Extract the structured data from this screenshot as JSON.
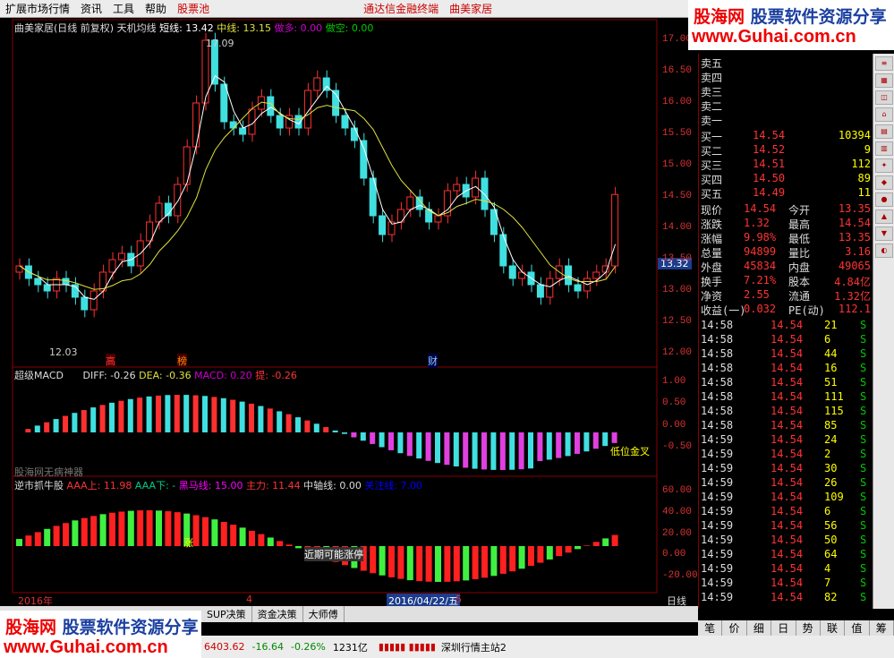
{
  "menubar": {
    "items": [
      "扩展市场行情",
      "资讯",
      "工具",
      "帮助",
      "股票池"
    ],
    "center1": "通达信金融终端",
    "center2": "曲美家居"
  },
  "watermark": {
    "brand": "股海网",
    "sub": "股票软件资源分享",
    "url": "www.Guhai.com.cn"
  },
  "kline_header": {
    "title": "曲美家居(日线 前复权) 天机均线",
    "short_label": "短线: 13.42",
    "mid_label": "中线: 13.15",
    "long_label": "做多: 0.00",
    "short_label2": "做空: 0.00",
    "high_mark": "17.09",
    "low_mark": "12.03",
    "current_price": "13.32"
  },
  "kline_yaxis": [
    "17.00",
    "16.50",
    "16.00",
    "15.50",
    "15.00",
    "14.50",
    "14.00",
    "13.50",
    "13.00",
    "12.50",
    "12.00"
  ],
  "kline_tags": {
    "gao": "高",
    "bang": "榜",
    "cai": "财"
  },
  "macd_header": {
    "title": "超级MACD",
    "diff": "DIFF: -0.26",
    "dea": "DEA: -0.36",
    "macd": "MACD: 0.20",
    "note": "提: -0.26"
  },
  "macd_yaxis": [
    "1.00",
    "0.50",
    "0.00",
    "-0.50"
  ],
  "macd_label": "低位金叉",
  "macd_bottom": "股海网无病神器",
  "niu_header": {
    "title": "逆市抓牛股",
    "aaa_up": "AAA上: 11.98",
    "aaa_down": "AAA下: -",
    "black_horse": "黑马线: 15.00",
    "main": "主力: 11.44",
    "mid": "中轴线: 0.00",
    "focus": "关注线: 7.00"
  },
  "niu_yaxis": [
    "60.00",
    "40.00",
    "20.00",
    "0.00",
    "-20.00"
  ],
  "niu_label": "近期可能涨停",
  "niu_zhang": "涨",
  "xaxis": {
    "y2016": "2016年",
    "m4": "4",
    "date": "2016/04/22/五",
    "m5": "5",
    "period": "日线"
  },
  "bottom_tabs": [
    "SUP决策",
    "资金决策",
    "大师傅"
  ],
  "quote": {
    "sell": [
      {
        "l": "卖五",
        "p": "",
        "v": ""
      },
      {
        "l": "卖四",
        "p": "",
        "v": ""
      },
      {
        "l": "卖三",
        "p": "",
        "v": ""
      },
      {
        "l": "卖二",
        "p": "",
        "v": ""
      },
      {
        "l": "卖一",
        "p": "",
        "v": ""
      }
    ],
    "buy": [
      {
        "l": "买一",
        "p": "14.54",
        "v": "10394"
      },
      {
        "l": "买二",
        "p": "14.52",
        "v": "9"
      },
      {
        "l": "买三",
        "p": "14.51",
        "v": "112"
      },
      {
        "l": "买四",
        "p": "14.50",
        "v": "89"
      },
      {
        "l": "买五",
        "p": "14.49",
        "v": "11"
      }
    ],
    "stats": [
      {
        "a": "现价",
        "b": "14.54",
        "c": "今开",
        "d": "13.35"
      },
      {
        "a": "涨跌",
        "b": "1.32",
        "c": "最高",
        "d": "14.54"
      },
      {
        "a": "涨幅",
        "b": "9.98%",
        "c": "最低",
        "d": "13.35"
      },
      {
        "a": "总量",
        "b": "94899",
        "c": "量比",
        "d": "3.16"
      },
      {
        "a": "外盘",
        "b": "45834",
        "c": "内盘",
        "d": "49065"
      },
      {
        "a": "换手",
        "b": "7.21%",
        "c": "股本",
        "d": "4.84亿"
      },
      {
        "a": "净资",
        "b": "2.55",
        "c": "流通",
        "d": "1.32亿"
      },
      {
        "a": "收益(一)",
        "b": "0.032",
        "c": "PE(动)",
        "d": "112.1"
      }
    ],
    "ticks": [
      {
        "t": "14:58",
        "p": "14.54",
        "v": "21",
        "s": "S"
      },
      {
        "t": "14:58",
        "p": "14.54",
        "v": "6",
        "s": "S"
      },
      {
        "t": "14:58",
        "p": "14.54",
        "v": "44",
        "s": "S"
      },
      {
        "t": "14:58",
        "p": "14.54",
        "v": "16",
        "s": "S"
      },
      {
        "t": "14:58",
        "p": "14.54",
        "v": "51",
        "s": "S"
      },
      {
        "t": "14:58",
        "p": "14.54",
        "v": "111",
        "s": "S"
      },
      {
        "t": "14:58",
        "p": "14.54",
        "v": "115",
        "s": "S"
      },
      {
        "t": "14:58",
        "p": "14.54",
        "v": "85",
        "s": "S"
      },
      {
        "t": "14:59",
        "p": "14.54",
        "v": "24",
        "s": "S"
      },
      {
        "t": "14:59",
        "p": "14.54",
        "v": "2",
        "s": "S"
      },
      {
        "t": "14:59",
        "p": "14.54",
        "v": "30",
        "s": "S"
      },
      {
        "t": "14:59",
        "p": "14.54",
        "v": "26",
        "s": "S"
      },
      {
        "t": "14:59",
        "p": "14.54",
        "v": "109",
        "s": "S"
      },
      {
        "t": "14:59",
        "p": "14.54",
        "v": "6",
        "s": "S"
      },
      {
        "t": "14:59",
        "p": "14.54",
        "v": "56",
        "s": "S"
      },
      {
        "t": "14:59",
        "p": "14.54",
        "v": "50",
        "s": "S"
      },
      {
        "t": "14:59",
        "p": "14.54",
        "v": "64",
        "s": "S"
      },
      {
        "t": "14:59",
        "p": "14.54",
        "v": "4",
        "s": "S"
      },
      {
        "t": "14:59",
        "p": "14.54",
        "v": "7",
        "s": "S"
      },
      {
        "t": "14:59",
        "p": "14.54",
        "v": "82",
        "s": "S"
      }
    ]
  },
  "right_tabs": [
    "笔",
    "价",
    "细",
    "日",
    "势",
    "联",
    "值",
    "筹"
  ],
  "status": {
    "index": "6403.62",
    "chg": "-16.64",
    "pct": "-0.26%",
    "amount": "1231亿",
    "server": "深圳行情主站2"
  },
  "colors": {
    "up": "#ff3030",
    "down": "#40e0e0",
    "ma_short": "#ffffff",
    "ma_mid": "#e0e040"
  }
}
